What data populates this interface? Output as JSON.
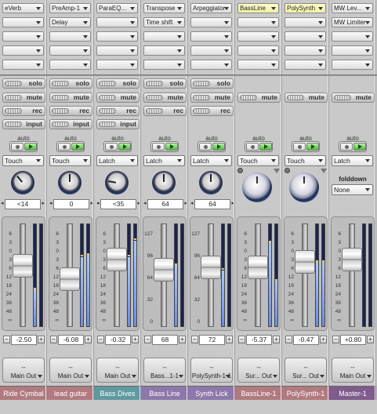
{
  "channels": [
    {
      "inserts": [
        "eVerb",
        "",
        "",
        "",
        ""
      ],
      "highlight_insert": -1,
      "buttons": [
        "solo",
        "mute",
        "rec",
        "input"
      ],
      "auto_label": "auto",
      "mode": "Touch",
      "pan": "<14",
      "volume": "-2.50",
      "route_top": "--",
      "route_out": "Main Out",
      "name": "Ride Cymbal",
      "color": "#b07a80",
      "knob_angle": -40,
      "fader": 0.38,
      "meters": [
        0.36,
        0.0
      ]
    },
    {
      "inserts": [
        "PreAmp-1",
        "Delay",
        "",
        "",
        ""
      ],
      "highlight_insert": -1,
      "buttons": [
        "solo",
        "mute",
        "rec",
        "input"
      ],
      "auto_label": "auto",
      "mode": "Touch",
      "pan": "0",
      "volume": "-6.08",
      "route_top": "--",
      "route_out": "Main Out",
      "name": "lead guitar",
      "color": "#b07a80",
      "knob_angle": 0,
      "fader": 0.55,
      "meters": [
        0.68,
        0.7
      ]
    },
    {
      "inserts": [
        "ParaEQ...",
        "",
        "",
        "",
        ""
      ],
      "highlight_insert": -1,
      "buttons": [
        "solo",
        "mute",
        "rec",
        "input"
      ],
      "auto_label": "auto",
      "mode": "Latch",
      "pan": "<35",
      "volume": "-0.32",
      "route_top": "--",
      "route_out": "Main Out",
      "name": "Bass Dives",
      "color": "#5e9aa0",
      "knob_angle": -80,
      "fader": 0.3,
      "meters": [
        0.68,
        0.84
      ]
    },
    {
      "inserts": [
        "Transpose",
        "Time shift",
        "",
        "",
        ""
      ],
      "highlight_insert": -1,
      "buttons": [
        "solo",
        "mute",
        "rec"
      ],
      "auto_label": "auto",
      "mode": "Latch",
      "pan": "64",
      "volume": "68",
      "route_top": "--",
      "route_out": "Bass...1-1",
      "name": "Bass Line",
      "color": "#8c78aa",
      "knob_angle": 0,
      "fader": 0.43,
      "meters": [
        0.6,
        0.0
      ]
    },
    {
      "inserts": [
        "Arpeggiator",
        "",
        "",
        "",
        ""
      ],
      "highlight_insert": -1,
      "buttons": [
        "solo",
        "mute",
        "rec"
      ],
      "auto_label": "auto",
      "mode": "Latch",
      "pan": "64",
      "volume": "72",
      "route_top": "--",
      "route_out": "PolySynth-1-1",
      "name": "Synth Lick",
      "color": "#8c78aa",
      "knob_angle": 0,
      "fader": 0.4,
      "meters": [
        0.55,
        0.0
      ]
    },
    {
      "inserts": [
        "BassLine",
        "",
        "",
        "",
        ""
      ],
      "highlight_insert": 0,
      "buttons": [
        "mute"
      ],
      "auto_label": "auto",
      "mode": "Touch",
      "pan": "",
      "volume": "-5.37",
      "route_top": "--",
      "route_out": "Sur... Out",
      "name": "BassLine-1",
      "color": "#b07a80",
      "knob_angle": 0,
      "fader": 0.4,
      "meters": [
        0.82,
        0.45
      ]
    },
    {
      "inserts": [
        "PolySynth",
        "",
        "",
        "",
        ""
      ],
      "highlight_insert": 0,
      "buttons": [
        "mute"
      ],
      "auto_label": "auto",
      "mode": "Touch",
      "pan": "",
      "volume": "-0.47",
      "route_top": "--",
      "route_out": "Sur... Out",
      "name": "PolySynth-1",
      "color": "#b07a80",
      "knob_angle": 0,
      "fader": 0.33,
      "meters": [
        0.63,
        0.63
      ]
    },
    {
      "inserts": [
        "MW Lev...",
        "MW Limiter",
        "",
        "",
        ""
      ],
      "highlight_insert": -1,
      "buttons": [
        "mute"
      ],
      "auto_label": "auto",
      "mode": "Latch",
      "pan": "",
      "volume": "+0.80",
      "route_top": "--",
      "route_out": "Main Out",
      "name": "Master-1",
      "color": "#7f5c8c",
      "knob_angle": 0,
      "fader": 0.3,
      "meters": [
        0.0,
        0.0
      ]
    }
  ],
  "foldown": {
    "label": "folddown",
    "value": "None"
  },
  "scale": {
    "db": [
      "6",
      "3",
      "0",
      "3",
      "6",
      "12",
      "18",
      "24",
      "36",
      "48",
      "∞"
    ],
    "midi": [
      "127",
      "96",
      "64",
      "32",
      "0"
    ]
  },
  "plus_label": "+",
  "minus_label": "−"
}
